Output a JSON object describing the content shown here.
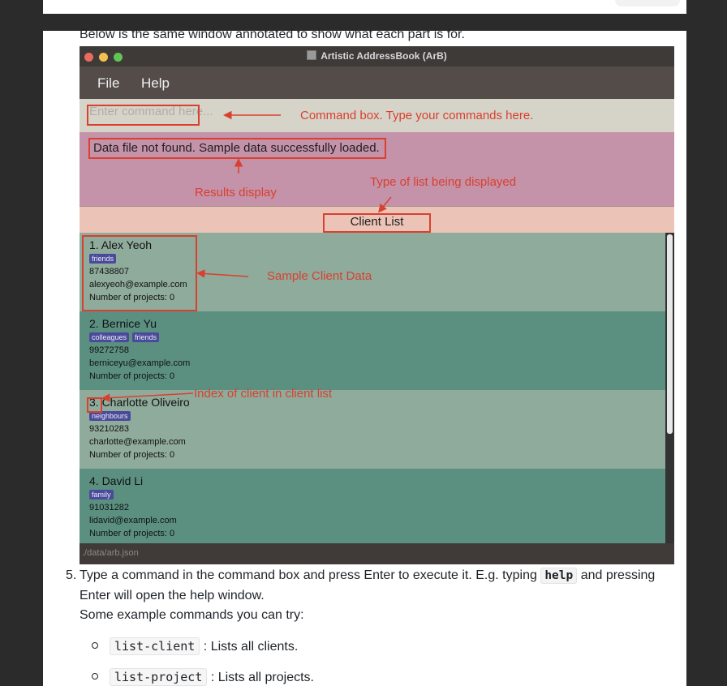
{
  "intro_text": "Below is the same window annotated to show what each part is for.",
  "window": {
    "title": "Artistic AddressBook (ArB)",
    "menu": [
      "File",
      "Help"
    ],
    "command_placeholder": "Enter command here...",
    "result_text": "Data file not found. Sample data successfully loaded.",
    "list_type": "Client List",
    "status": "./data/arb.json"
  },
  "clients": [
    {
      "name": "1.  Alex Yeoh",
      "tags": [
        "friends"
      ],
      "phone": "87438807",
      "email": "alexyeoh@example.com",
      "projects": "Number of projects: 0"
    },
    {
      "name": "2.  Bernice Yu",
      "tags": [
        "colleagues",
        "friends"
      ],
      "phone": "99272758",
      "email": "berniceyu@example.com",
      "projects": "Number of projects: 0"
    },
    {
      "name": "3.  Charlotte Oliveiro",
      "tags": [
        "neighbours"
      ],
      "phone": "93210283",
      "email": "charlotte@example.com",
      "projects": "Number of projects: 0"
    },
    {
      "name": "4.  David Li",
      "tags": [
        "family"
      ],
      "phone": "91031282",
      "email": "lidavid@example.com",
      "projects": "Number of projects: 0"
    }
  ],
  "annotations": {
    "command_box": "Command box. Type your commands here.",
    "results_display": "Results display",
    "list_type": "Type of list being displayed",
    "sample_data": "Sample Client Data",
    "index": "Index of client in client list"
  },
  "step": {
    "number": "5.",
    "text_before": "Type a command in the command box and press Enter to execute it. E.g. typing",
    "code": "help",
    "text_after": "and pressing Enter will open the help window.",
    "examples_intro": "Some example commands you can try:"
  },
  "examples": [
    {
      "cmd": "list-client",
      "desc": ": Lists all clients."
    },
    {
      "cmd": "list-project",
      "desc": ": Lists all projects."
    }
  ],
  "colors": {
    "annotation": "#d9402f",
    "tag": "#4a4a9a"
  }
}
